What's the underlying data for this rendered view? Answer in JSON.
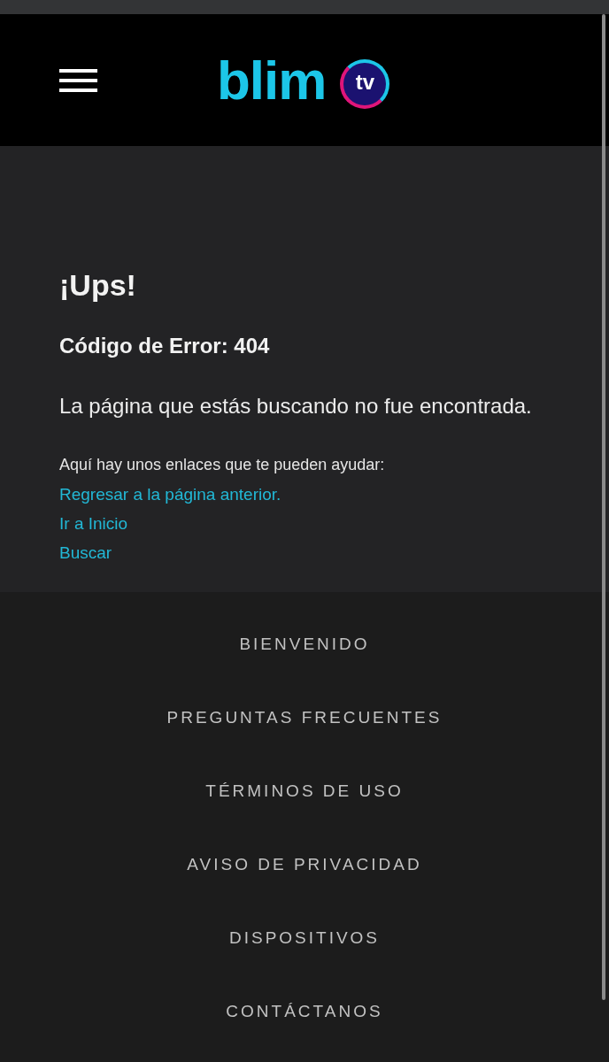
{
  "header": {
    "logo": {
      "wordmark": "blim",
      "badge": "tv"
    }
  },
  "error": {
    "title": "¡Ups!",
    "code": "Código de Error: 404",
    "message": "La página que estás buscando no fue encontrada.",
    "help_text": "Aquí hay unos enlaces que te pueden ayudar:",
    "links": [
      "Regresar a la página anterior.",
      "Ir a Inicio",
      "Buscar"
    ]
  },
  "footer": {
    "links": [
      "BIENVENIDO",
      "PREGUNTAS FRECUENTES",
      "TÉRMINOS DE USO",
      "AVISO DE PRIVACIDAD",
      "DISPOSITIVOS",
      "CONTÁCTANOS"
    ]
  }
}
